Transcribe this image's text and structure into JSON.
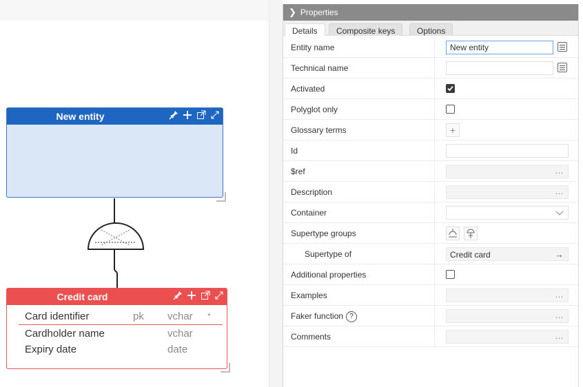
{
  "canvas": {
    "entities": [
      {
        "title": "New entity",
        "color": "#1f66c2"
      },
      {
        "title": "Credit card",
        "color": "#ec4f50",
        "attributes": [
          {
            "name": "Card identifier",
            "key": "pk",
            "type": "vchar",
            "required": "*"
          },
          {
            "name": "Cardholder name",
            "key": "",
            "type": "vchar",
            "required": ""
          },
          {
            "name": "Expiry date",
            "key": "",
            "type": "date",
            "required": ""
          }
        ]
      }
    ]
  },
  "panel": {
    "title": "Properties",
    "tabs": [
      "Details",
      "Composite keys",
      "Options"
    ],
    "active_tab": "Details",
    "rows": [
      {
        "label": "Entity name",
        "value": "New entity"
      },
      {
        "label": "Technical name",
        "value": ""
      },
      {
        "label": "Activated",
        "checked": true
      },
      {
        "label": "Polyglot only",
        "checked": false
      },
      {
        "label": "Glossary terms",
        "button": "+"
      },
      {
        "label": "Id",
        "value": ""
      },
      {
        "label": "$ref",
        "value": ""
      },
      {
        "label": "Description",
        "value": ""
      },
      {
        "label": "Container",
        "value": ""
      },
      {
        "label": "Supertype groups"
      },
      {
        "label": "Supertype of",
        "value": "Credit card"
      },
      {
        "label": "Additional properties",
        "checked": false
      },
      {
        "label": "Examples",
        "value": ""
      },
      {
        "label": "Faker function",
        "help": "?"
      },
      {
        "label": "Comments",
        "value": ""
      }
    ],
    "ellipsis": "...",
    "arrow": "→"
  }
}
